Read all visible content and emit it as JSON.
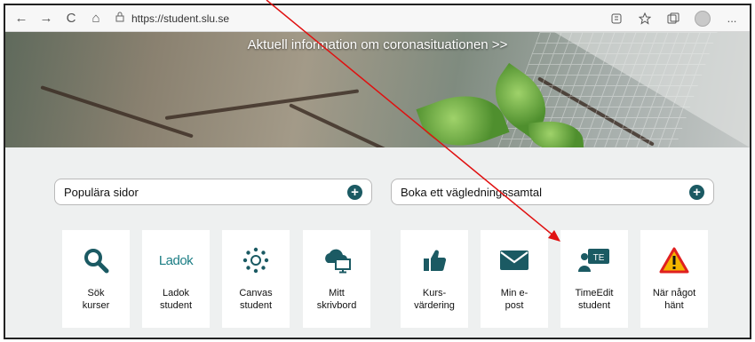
{
  "browser": {
    "back_icon": "←",
    "forward_icon": "→",
    "reload_icon": "C",
    "home_icon": "⌂",
    "lock_icon": "🔒",
    "url": "https://student.slu.se",
    "more_icon": "..."
  },
  "hero": {
    "link_text": "Aktuell information om coronasituationen >>"
  },
  "dropdowns": {
    "popular": "Populära sidor",
    "booking": "Boka ett vägledningssamtal",
    "plus_icon": "+"
  },
  "tiles": [
    {
      "line1": "Sök",
      "line2": "kurser",
      "icon": "search-icon"
    },
    {
      "line1": "Ladok",
      "line2": "student",
      "icon": "ladok-logo",
      "logo_text": "Ladok"
    },
    {
      "line1": "Canvas",
      "line2": "student",
      "icon": "canvas-icon"
    },
    {
      "line1": "Mitt",
      "line2": "skrivbord",
      "icon": "cloud-desktop-icon"
    },
    {
      "line1": "Kurs-",
      "line2": "värdering",
      "icon": "thumbs-up-icon"
    },
    {
      "line1": "Min e-",
      "line2": "post",
      "icon": "envelope-icon"
    },
    {
      "line1": "TimeEdit",
      "line2": "student",
      "icon": "timeedit-icon",
      "logo_text": "TE"
    },
    {
      "line1": "När något",
      "line2": "hänt",
      "icon": "warning-icon"
    }
  ],
  "colors": {
    "accent": "#1b7d84",
    "dark_teal": "#1b5a63",
    "warning_red": "#e02020",
    "warning_yellow": "#f4b400",
    "annotation": "#e01010"
  }
}
